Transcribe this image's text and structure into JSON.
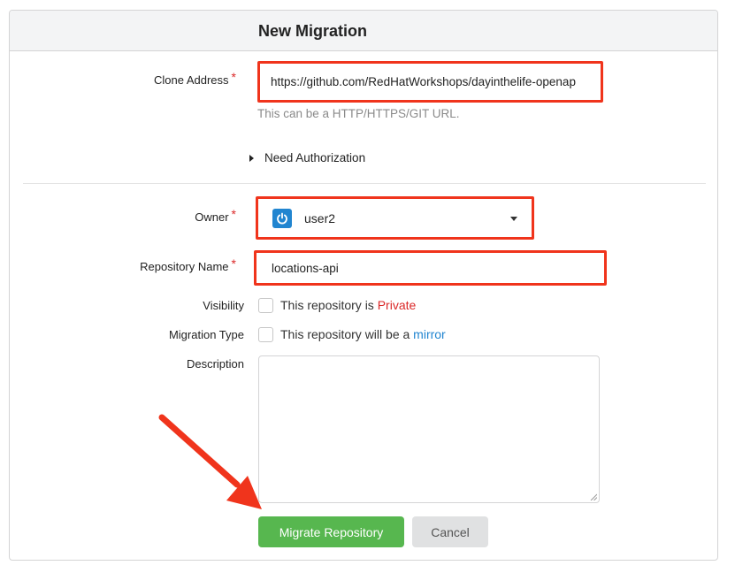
{
  "page": {
    "title": "New Migration"
  },
  "form": {
    "clone_address": {
      "label": "Clone Address",
      "required_mark": "*",
      "value": "https://github.com/RedHatWorkshops/dayinthelife-openap",
      "help": "This can be a HTTP/HTTPS/GIT URL."
    },
    "auth_toggle": {
      "label": "Need Authorization"
    },
    "owner": {
      "label": "Owner",
      "required_mark": "*",
      "value": "user2",
      "icon": "power-icon"
    },
    "repo_name": {
      "label": "Repository Name",
      "required_mark": "*",
      "value": "locations-api"
    },
    "visibility": {
      "label": "Visibility",
      "text_prefix": "This repository is",
      "text_highlight": "Private",
      "checked": false
    },
    "migration_type": {
      "label": "Migration Type",
      "text_prefix": "This repository will be a",
      "text_highlight": "mirror",
      "checked": false
    },
    "description": {
      "label": "Description",
      "value": ""
    }
  },
  "buttons": {
    "migrate": "Migrate Repository",
    "cancel": "Cancel"
  },
  "annotations": {
    "highlight_color": "#f0341c",
    "arrow_color": "#f0341c"
  },
  "colors": {
    "primary": "#57b74f",
    "required": "#db2828",
    "link": "#2185d0"
  }
}
